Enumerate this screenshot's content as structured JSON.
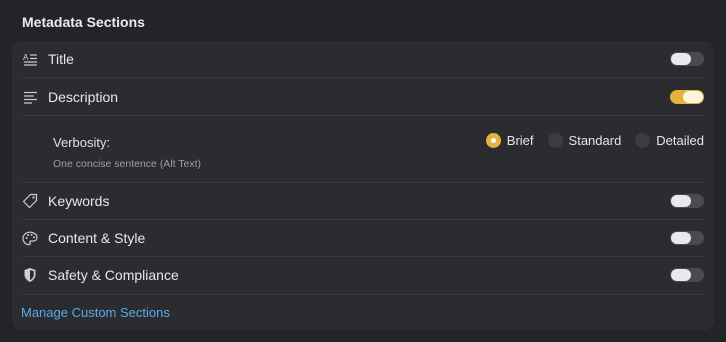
{
  "header": {
    "title": "Metadata Sections"
  },
  "sections": [
    {
      "label": "Title",
      "icon": "title-text-icon",
      "enabled": false
    },
    {
      "label": "Description",
      "icon": "paragraph-lines-icon",
      "enabled": true
    },
    {
      "label": "Keywords",
      "icon": "tag-icon",
      "enabled": false
    },
    {
      "label": "Content & Style",
      "icon": "palette-icon",
      "enabled": false
    },
    {
      "label": "Safety & Compliance",
      "icon": "shield-icon",
      "enabled": false
    }
  ],
  "verbosity": {
    "label": "Verbosity:",
    "hint": "One concise sentence (Alt Text)",
    "options": [
      "Brief",
      "Standard",
      "Detailed"
    ],
    "selected": "Brief"
  },
  "footer": {
    "manage_link": "Manage Custom Sections"
  },
  "colors": {
    "accent": "#e4b33c",
    "link": "#5aa9e8",
    "background": "#232428",
    "panel": "#2b2c30"
  }
}
